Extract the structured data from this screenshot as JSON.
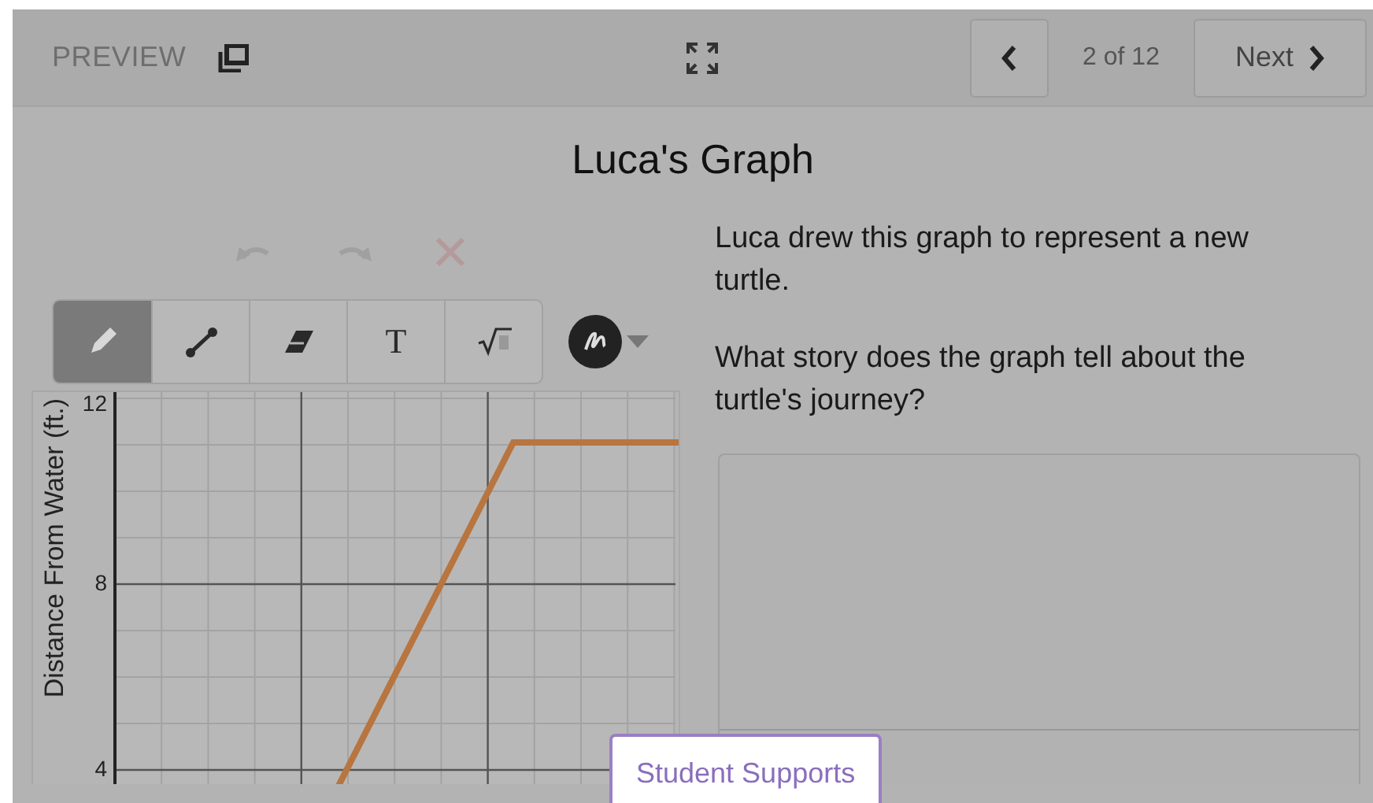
{
  "header": {
    "label": "PREVIEW",
    "page": "2 of 12",
    "next": "Next"
  },
  "title": "Luca's Graph",
  "tools": [
    {
      "kind": "pencil",
      "selected": true
    },
    {
      "kind": "line",
      "selected": false
    },
    {
      "kind": "eraser",
      "selected": false
    },
    {
      "kind": "text",
      "label": "T",
      "selected": false
    },
    {
      "kind": "math",
      "selected": false
    }
  ],
  "graph": {
    "y_axis_label": "Distance From Water (ft.)",
    "y_ticks": [
      "12",
      "8",
      "4"
    ]
  },
  "question": {
    "paragraphs": [
      "Luca drew this graph to represent a new turtle.",
      "What story does the graph tell about the turtle's journey?"
    ]
  },
  "supports_tab": "Student Supports"
}
